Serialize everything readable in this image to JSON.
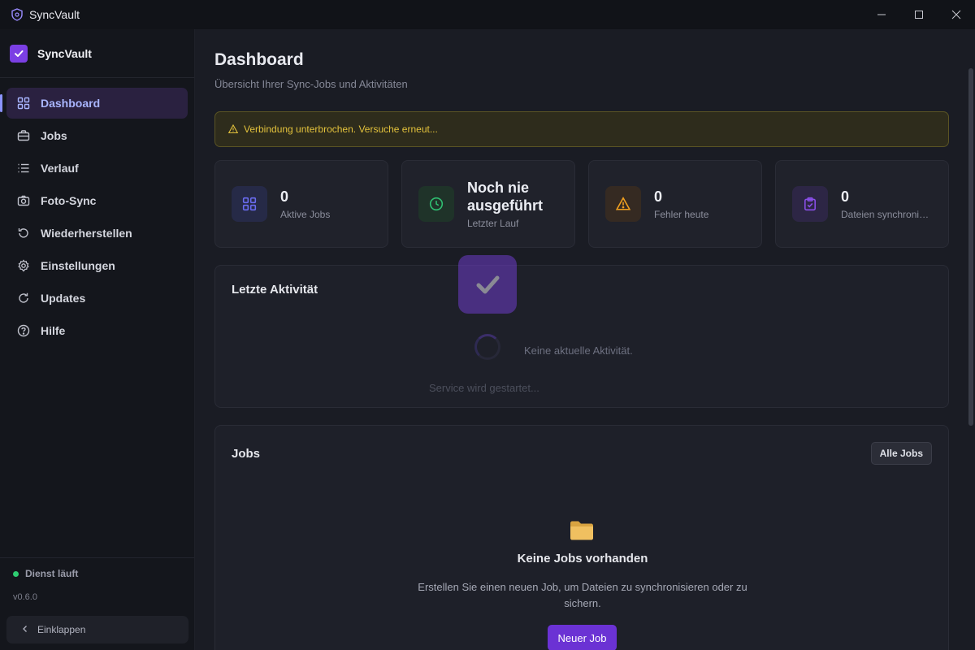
{
  "window": {
    "title": "SyncVault"
  },
  "sidebar": {
    "brand": "SyncVault",
    "items": [
      {
        "label": "Dashboard",
        "icon": "grid-icon",
        "active": true
      },
      {
        "label": "Jobs",
        "icon": "briefcase-icon"
      },
      {
        "label": "Verlauf",
        "icon": "list-icon"
      },
      {
        "label": "Foto-Sync",
        "icon": "camera-icon"
      },
      {
        "label": "Wiederherstellen",
        "icon": "restore-icon"
      },
      {
        "label": "Einstellungen",
        "icon": "gear-icon"
      },
      {
        "label": "Updates",
        "icon": "refresh-icon"
      },
      {
        "label": "Hilfe",
        "icon": "help-icon"
      }
    ],
    "service_status": "Dienst läuft",
    "version": "v0.6.0",
    "collapse_label": "Einklappen"
  },
  "main": {
    "title": "Dashboard",
    "subtitle": "Übersicht Ihrer Sync-Jobs und Aktivitäten",
    "alert": "Verbindung unterbrochen. Versuche erneut...",
    "stats": [
      {
        "value": "0",
        "label": "Aktive Jobs",
        "icon": "grid-icon",
        "color": "#6a6cf0"
      },
      {
        "value": "Noch nie ausgeführt",
        "label": "Letzter Lauf",
        "icon": "clock-icon",
        "color": "#2fbf71"
      },
      {
        "value": "0",
        "label": "Fehler heute",
        "icon": "warning-icon",
        "color": "#f0a020"
      },
      {
        "value": "0",
        "label": "Dateien synchronisiert",
        "icon": "clipboard-check-icon",
        "color": "#8a4fe8"
      }
    ],
    "activity": {
      "title": "Letzte Aktivität",
      "empty": "Keine aktuelle Aktivität."
    },
    "loading_text": "Service wird gestartet...",
    "jobs": {
      "title": "Jobs",
      "all_jobs_label": "Alle Jobs",
      "empty_title": "Keine Jobs vorhanden",
      "empty_desc": "Erstellen Sie einen neuen Job, um Dateien zu synchronisieren oder zu sichern.",
      "new_job_label": "Neuer Job"
    }
  },
  "colors": {
    "accent": "#6b32d4",
    "active_nav": "#a9b6ff",
    "warning": "#e3c23c",
    "success": "#2ecc71"
  }
}
